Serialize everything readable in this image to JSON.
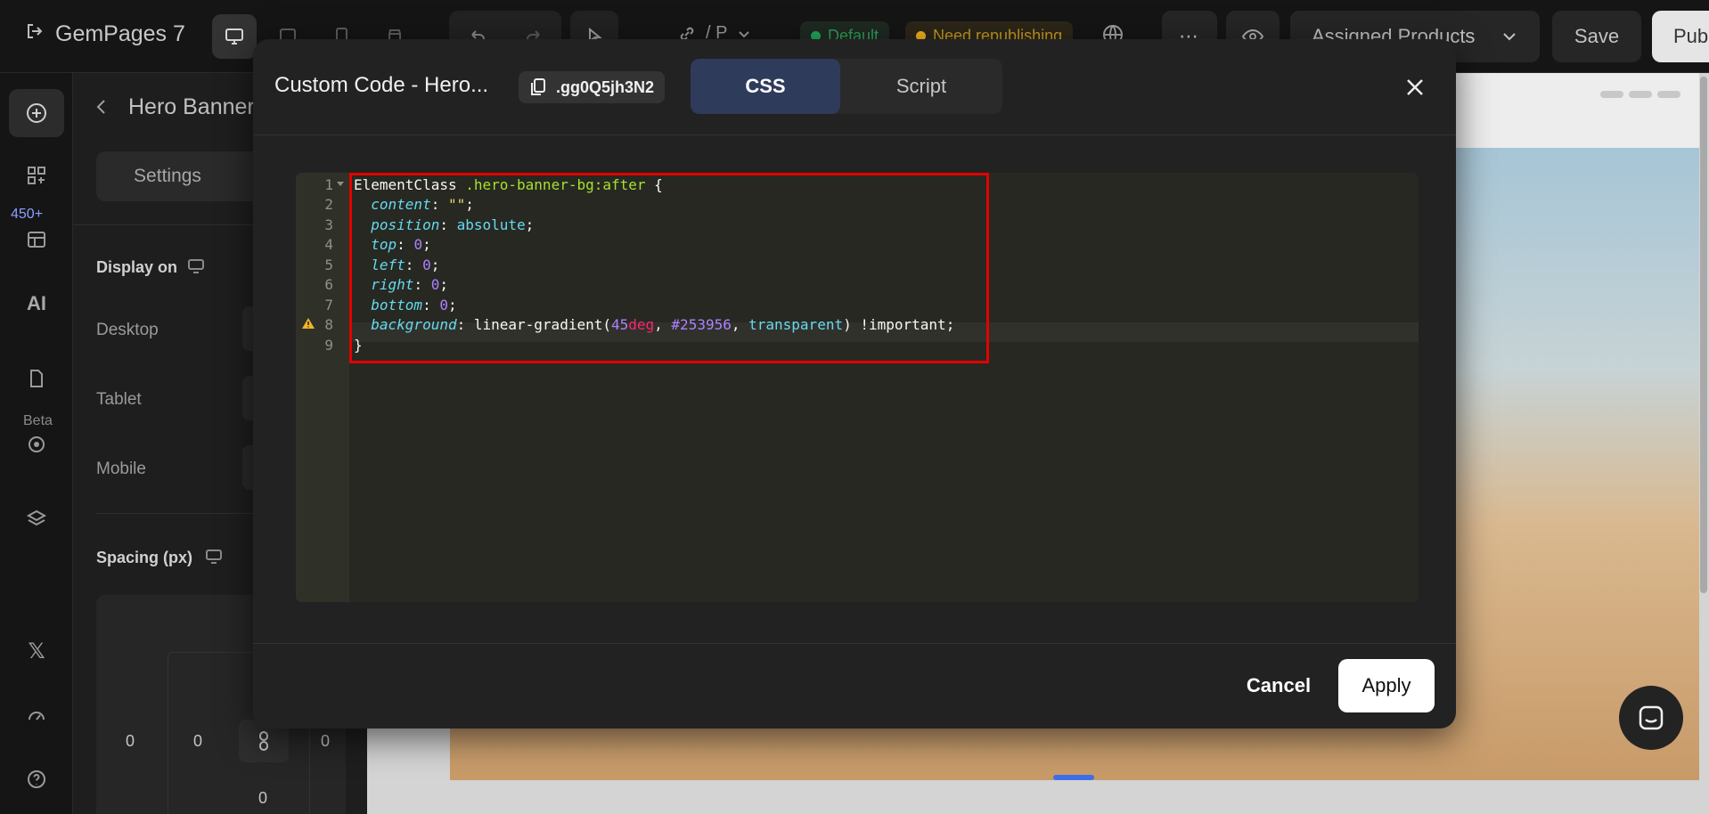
{
  "app": {
    "name": "GemPages 7"
  },
  "topbar": {
    "page_name": "/ P",
    "status_default": "Default",
    "status_warning": "Need republishing",
    "assigned_products": "Assigned Products",
    "save_label": "Save",
    "publish_label": "Pub",
    "default_color": "#23a55a",
    "warning_color": "#f3b21d"
  },
  "leftrail": {
    "badge_count": "450+",
    "beta_label": "Beta"
  },
  "sidepanel": {
    "title": "Hero Banner",
    "tab_settings": "Settings",
    "display_on": "Display on",
    "desktop": "Desktop",
    "tablet": "Tablet",
    "mobile": "Mobile",
    "spacing": "Spacing (px)",
    "spacing_values": {
      "top_inner": "",
      "left_outer": "0",
      "left_inner": "0",
      "right_inner": "0",
      "right_outer": "0",
      "bottom": "0"
    }
  },
  "modal": {
    "title": "Custom Code - Hero...",
    "class_name": ".gg0Q5jh3N2",
    "tab_css": "CSS",
    "tab_script": "Script",
    "cancel_label": "Cancel",
    "apply_label": "Apply",
    "line_numbers": [
      "1",
      "2",
      "3",
      "4",
      "5",
      "6",
      "7",
      "8",
      "9"
    ],
    "warning_line": "8",
    "code": {
      "l1_sel": "ElementClass ",
      "l1_cls": ".hero-banner-bg:after",
      "l1_rest": " {",
      "l2_prop": "content",
      "l2_val": "\"\"",
      "l3_prop": "position",
      "l3_val": "absolute",
      "l4_prop": "top",
      "l4_val": "0",
      "l5_prop": "left",
      "l5_val": "0",
      "l6_prop": "right",
      "l6_val": "0",
      "l7_prop": "bottom",
      "l7_val": "0",
      "l8_prop": "background",
      "l8_fn": "linear-gradient(",
      "l8_num": "45",
      "l8_unit": "deg",
      "l8_color": "#253956",
      "l8_transparent": "transparent",
      "l8_tail": ") !important;",
      "l9": "}"
    }
  },
  "colors": {
    "accent": "#2f3b5a",
    "highlight_border": "#e30000"
  },
  "icons": {
    "exit": "exit-icon",
    "desktop": "desktop-icon",
    "tablet": "tablet-icon",
    "mobile": "mobile-icon",
    "store": "store-icon",
    "undo": "undo-icon",
    "redo": "redo-icon",
    "link": "link-icon",
    "globe": "globe-icon",
    "more": "more-icon",
    "eye": "eye-icon",
    "copy": "copy-icon",
    "close": "close-icon",
    "chat": "chat-icon"
  }
}
